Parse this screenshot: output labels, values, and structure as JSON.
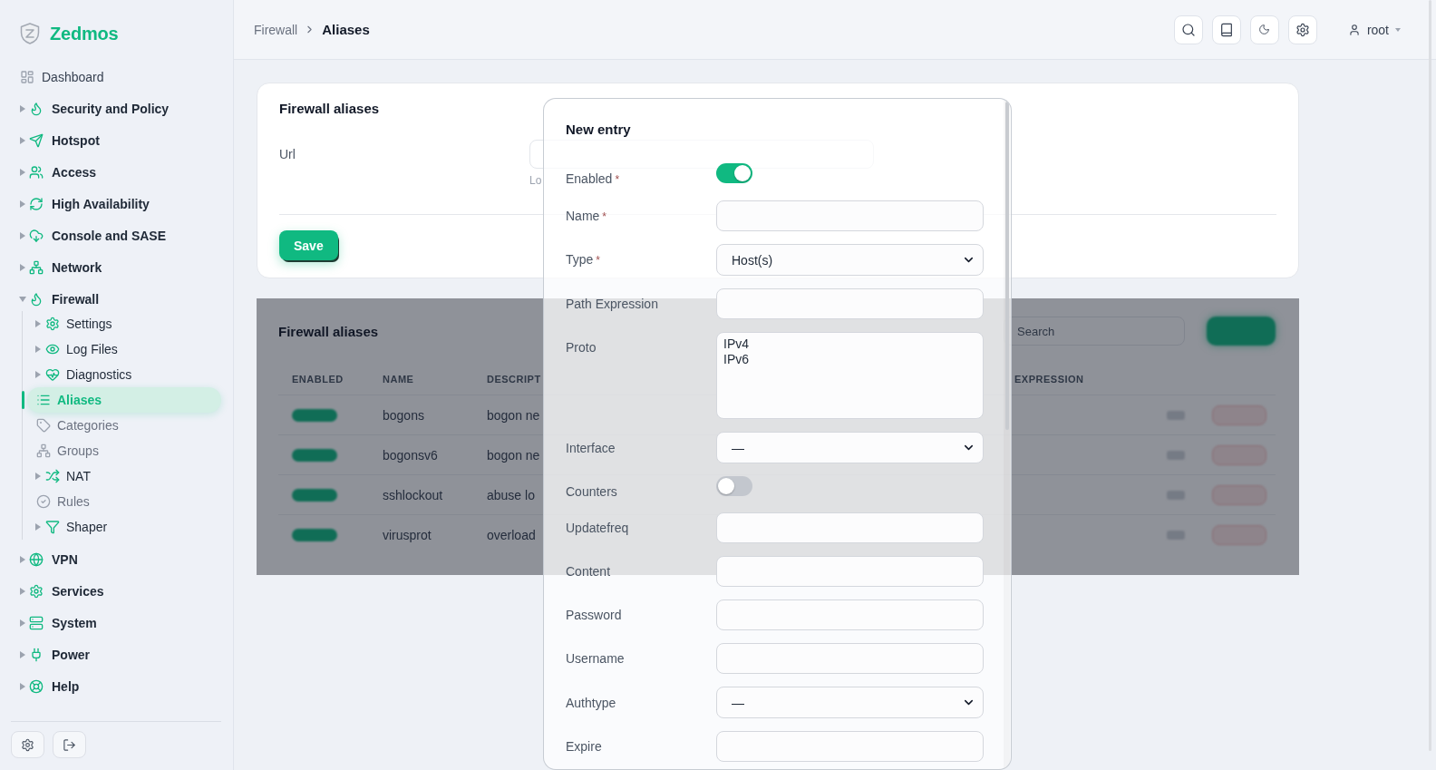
{
  "brand": {
    "name": "Zedmos"
  },
  "sidebar": {
    "items": [
      {
        "kind": "page",
        "label": "Dashboard",
        "selected": false
      },
      {
        "kind": "group",
        "label": "Security and Policy",
        "expanded": false,
        "selected": false
      },
      {
        "kind": "group",
        "label": "Hotspot",
        "expanded": false,
        "selected": false
      },
      {
        "kind": "group",
        "label": "Access",
        "expanded": false,
        "selected": false
      },
      {
        "kind": "group",
        "label": "High Availability",
        "expanded": false,
        "selected": false
      },
      {
        "kind": "group",
        "label": "Console and SASE",
        "expanded": false,
        "selected": false
      },
      {
        "kind": "group",
        "label": "Network",
        "expanded": false,
        "selected": false
      },
      {
        "kind": "group",
        "label": "Firewall",
        "expanded": true,
        "selected": false,
        "children": [
          {
            "kind": "group",
            "label": "Settings",
            "expanded": false,
            "selected": false
          },
          {
            "kind": "group",
            "label": "Log Files",
            "expanded": false,
            "selected": false
          },
          {
            "kind": "group",
            "label": "Diagnostics",
            "expanded": false,
            "selected": false
          },
          {
            "kind": "page",
            "label": "Aliases",
            "selected": true
          },
          {
            "kind": "page",
            "label": "Categories",
            "selected": false
          },
          {
            "kind": "page",
            "label": "Groups",
            "selected": false
          },
          {
            "kind": "group",
            "label": "NAT",
            "expanded": false,
            "selected": false
          },
          {
            "kind": "page",
            "label": "Rules",
            "selected": false
          },
          {
            "kind": "group",
            "label": "Shaper",
            "expanded": false,
            "selected": false
          }
        ]
      },
      {
        "kind": "group",
        "label": "VPN",
        "expanded": false,
        "selected": false
      },
      {
        "kind": "group",
        "label": "Services",
        "expanded": false,
        "selected": false
      },
      {
        "kind": "group",
        "label": "System",
        "expanded": false,
        "selected": false
      },
      {
        "kind": "group",
        "label": "Power",
        "expanded": false,
        "selected": false
      },
      {
        "kind": "group",
        "label": "Help",
        "expanded": false,
        "selected": false
      }
    ]
  },
  "header": {
    "breadcrumb": [
      {
        "label": "Firewall",
        "current": false
      },
      {
        "label": "Aliases",
        "current": true
      }
    ],
    "user": "root"
  },
  "settings_card": {
    "title": "Firewall aliases",
    "fields": [
      {
        "label": "Url",
        "help": "Lo"
      }
    ],
    "save_button": "Save"
  },
  "table_card": {
    "title": "Firewall aliases",
    "search": {
      "placeholder": "Search"
    },
    "columns": [
      "ENABLED",
      "NAME",
      "DESCRIPT",
      "EXPRESSION"
    ],
    "rows": [
      {
        "enabled": true,
        "name": "bogons",
        "description": "bogon ne"
      },
      {
        "enabled": true,
        "name": "bogonsv6",
        "description": "bogon ne"
      },
      {
        "enabled": true,
        "name": "sshlockout",
        "description": "abuse lo"
      },
      {
        "enabled": true,
        "name": "virusprot",
        "description": "overload"
      }
    ]
  },
  "modal": {
    "title": "New entry",
    "fields": [
      {
        "kind": "toggle",
        "label": "Enabled",
        "required_mark": "*",
        "on": true
      },
      {
        "kind": "input",
        "label": "Name",
        "required_mark": "*"
      },
      {
        "kind": "select",
        "label": "Type",
        "required_mark": "*",
        "value": "Host(s)"
      },
      {
        "kind": "input",
        "label": "Path Expression"
      },
      {
        "kind": "listbox",
        "label": "Proto",
        "options": [
          {
            "label": "IPv4",
            "selected": false
          },
          {
            "label": "IPv6",
            "selected": false
          }
        ]
      },
      {
        "kind": "select",
        "label": "Interface",
        "value": "—"
      },
      {
        "kind": "toggle",
        "label": "Counters",
        "on": false
      },
      {
        "kind": "input",
        "label": "Updatefreq"
      },
      {
        "kind": "input",
        "label": "Content"
      },
      {
        "kind": "input",
        "label": "Password"
      },
      {
        "kind": "input",
        "label": "Username"
      },
      {
        "kind": "select",
        "label": "Authtype",
        "value": "—"
      },
      {
        "kind": "input",
        "label": "Expire"
      }
    ]
  }
}
